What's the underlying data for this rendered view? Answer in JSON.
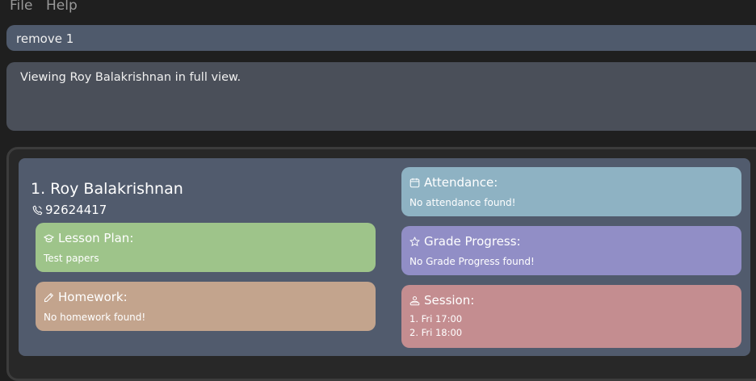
{
  "menu": {
    "file": "File",
    "help": "Help"
  },
  "command_box": {
    "value": "remove 1"
  },
  "result_box": {
    "text": "Viewing Roy Balakrishnan in full view."
  },
  "person": {
    "index_name": "1.  Roy Balakrishnan",
    "phone": "92624417"
  },
  "cards": {
    "lesson_plan": {
      "title": "Lesson Plan:",
      "body": "Test papers",
      "icon": "graduation-cap-icon",
      "color": "#9ec48a"
    },
    "homework": {
      "title": "Homework:",
      "body": "No homework found!",
      "icon": "pencil-icon",
      "color": "#c3a48d"
    },
    "attendance": {
      "title": "Attendance:",
      "body": "No attendance found!",
      "icon": "calendar-icon",
      "color": "#8eb2c3"
    },
    "grade_progress": {
      "title": "Grade Progress:",
      "body": "No Grade Progress found!",
      "icon": "star-icon",
      "color": "#918ec6"
    },
    "session": {
      "title": "Session:",
      "items": [
        "1. Fri 17:00",
        "2. Fri 18:00"
      ],
      "icon": "session-icon",
      "color": "#c48d90"
    }
  }
}
